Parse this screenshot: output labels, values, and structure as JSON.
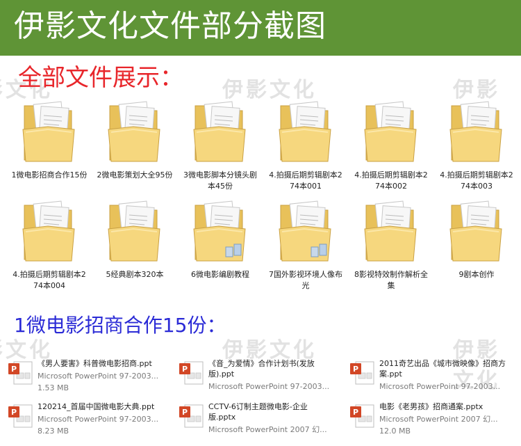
{
  "banner": {
    "title": "伊影文化文件部分截图"
  },
  "sections": {
    "all_files": "全部文件展示：",
    "section1": "1微电影招商合作15份："
  },
  "watermark": "伊影文化",
  "colors": {
    "banner": "#5f9436",
    "red_heading": "#e8262b",
    "blue_heading": "#2b2bd6",
    "folder": "#f3d57a"
  },
  "folders": [
    {
      "label": "1微电影招商合作15份",
      "icon": "folder-icon"
    },
    {
      "label": "2微电影策划大全95份",
      "icon": "folder-icon"
    },
    {
      "label": "3微电影脚本分镜头剧本45份",
      "icon": "folder-icon"
    },
    {
      "label": "4.拍摄后期剪辑剧本274本001",
      "icon": "folder-icon"
    },
    {
      "label": "4.拍摄后期剪辑剧本274本002",
      "icon": "folder-icon"
    },
    {
      "label": "4.拍摄后期剪辑剧本274本003",
      "icon": "folder-icon"
    },
    {
      "label": "4.拍摄后期剪辑剧本274本004",
      "icon": "folder-icon"
    },
    {
      "label": "5经典剧本320本",
      "icon": "folder-icon"
    },
    {
      "label": "6微电影编剧教程",
      "icon": "folder-icon"
    },
    {
      "label": "7国外影视环境人像布光",
      "icon": "folder-icon"
    },
    {
      "label": "8影视特效制作解析全集",
      "icon": "folder-icon"
    },
    {
      "label": "9剧本创作",
      "icon": "folder-icon"
    }
  ],
  "files": [
    {
      "name": "《男人要害》科普微电影招商.ppt",
      "type": "Microsoft PowerPoint 97-2003...",
      "size": "1.53 MB",
      "icon": "powerpoint-icon"
    },
    {
      "name": "《音_为爱情》合作计划书(发放版).ppt",
      "type": "Microsoft PowerPoint 97-2003...",
      "size": "",
      "icon": "powerpoint-icon"
    },
    {
      "name": "2011奇艺出品《城市微映像》招商方案.ppt",
      "type": "Microsoft PowerPoint 97-2003...",
      "size": "",
      "icon": "powerpoint-icon"
    },
    {
      "name": "120214_首届中国微电影大典.ppt",
      "type": "Microsoft PowerPoint 97-2003...",
      "size": "8.23 MB",
      "icon": "powerpoint-icon"
    },
    {
      "name": "CCTV-6订制主题微电影-企业版.pptx",
      "type": "Microsoft PowerPoint 2007 幻...",
      "size": "",
      "icon": "powerpoint-icon"
    },
    {
      "name": "电影《老男孩》招商通案.pptx",
      "type": "Microsoft PowerPoint 2007 幻...",
      "size": "12.0 MB",
      "icon": "powerpoint-icon"
    }
  ]
}
